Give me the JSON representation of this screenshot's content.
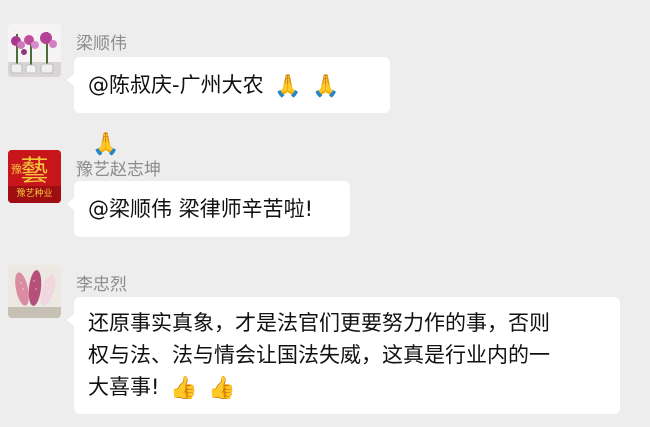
{
  "messages": [
    {
      "sender": "梁顺伟",
      "text": "@陈叔庆-广州大农",
      "emoji": [
        "🙏",
        "🙏",
        "🙏"
      ],
      "avatar": "orchid-flowers-photo"
    },
    {
      "sender": "豫艺赵志坤",
      "text": "@梁顺伟 梁律师辛苦啦!",
      "avatar": "yuyi-seed-logo",
      "avatar_text": {
        "main": "藝",
        "side": "豫",
        "bottom": "豫艺种业"
      }
    },
    {
      "sender": "李忠烈",
      "lines": [
        "还原事实真象，才是法官们更要努力作的事，否则",
        "权与法、法与情会让国法失威，这真是行业内的一",
        "大喜事!"
      ],
      "emoji": [
        "👍",
        "👍"
      ],
      "avatar": "corn-ears-photo"
    }
  ],
  "colors": {
    "background": "#ededed",
    "bubble": "#ffffff",
    "sender": "#8c8c8c",
    "text": "#111111",
    "logo_red": "#c8141b",
    "logo_gold": "#f3c63b"
  }
}
